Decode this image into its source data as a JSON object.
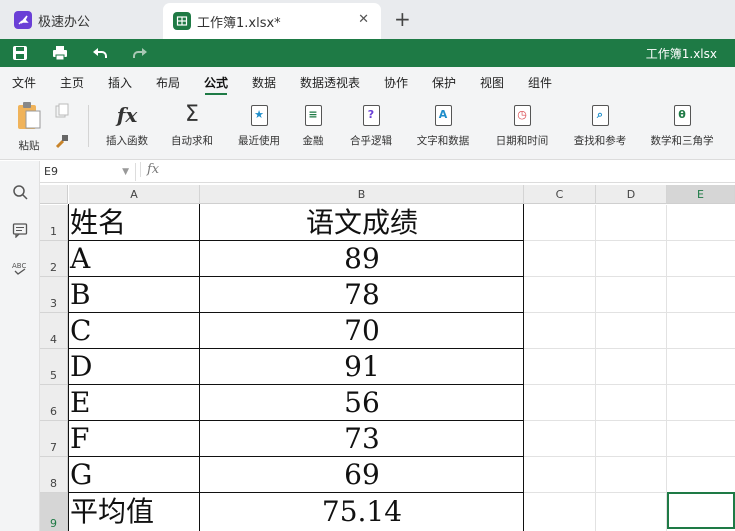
{
  "app_tabs": {
    "home_label": "极速办公",
    "doc_label": "工作簿1.xlsx*",
    "new_tab": "+"
  },
  "title_bar": {
    "doc_title": "工作簿1.xlsx"
  },
  "menu": [
    "文件",
    "主页",
    "插入",
    "布局",
    "公式",
    "数据",
    "数据透视表",
    "协作",
    "保护",
    "视图",
    "组件"
  ],
  "menu_active": "公式",
  "ribbon": {
    "paste": "粘贴",
    "insert_function": "插入函数",
    "autosum": "自动求和",
    "recent": "最近使用",
    "financial": "金融",
    "logical": "合乎逻辑",
    "text_data": "文字和数据",
    "date_time": "日期和时间",
    "lookup": "查找和参考",
    "math": "数学和三角学",
    "fx_glyph": "fx",
    "sigma_glyph": "Σ"
  },
  "formula_bar": {
    "name_box": "E9",
    "fx": "fx",
    "content": ""
  },
  "columns": [
    "A",
    "B",
    "C",
    "D",
    "E"
  ],
  "selected_column": "E",
  "rows": [
    "1",
    "2",
    "3",
    "4",
    "5",
    "6",
    "7",
    "8",
    "9"
  ],
  "selected_row": "9",
  "table": {
    "header": [
      "姓名",
      "语文成绩"
    ],
    "rows": [
      [
        "A",
        "89"
      ],
      [
        "B",
        "78"
      ],
      [
        "C",
        "70"
      ],
      [
        "D",
        "91"
      ],
      [
        "E",
        "56"
      ],
      [
        "F",
        "73"
      ],
      [
        "G",
        "69"
      ],
      [
        "平均值",
        "75.14"
      ]
    ]
  },
  "colors": {
    "brand_green": "#1e7a45",
    "home_icon": "#6a3fd6"
  }
}
